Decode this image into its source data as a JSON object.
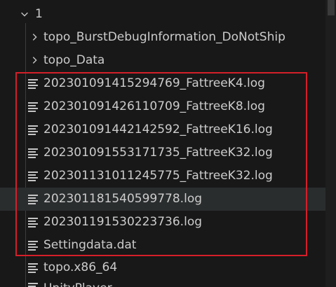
{
  "explorer": {
    "root_folder": {
      "label": "1",
      "expanded": true
    },
    "folders": [
      {
        "label": "topo_BurstDebugInformation_DoNotShip",
        "expanded": false
      },
      {
        "label": "topo_Data",
        "expanded": false
      }
    ],
    "files": [
      {
        "label": "202301091415294769_FattreeK4.log",
        "icon": "file-lines-icon"
      },
      {
        "label": "202301091426110709_FattreeK8.log",
        "icon": "file-lines-icon"
      },
      {
        "label": "202301091442142592_FattreeK16.log",
        "icon": "file-lines-icon"
      },
      {
        "label": "202301091553171735_FattreeK32.log",
        "icon": "file-lines-icon"
      },
      {
        "label": "202301131011245775_FattreeK32.log",
        "icon": "file-lines-icon"
      },
      {
        "label": "202301181540599778.log",
        "icon": "file-lines-icon"
      },
      {
        "label": "202301191530223736.log",
        "icon": "file-lines-icon"
      },
      {
        "label": "Settingdata.dat",
        "icon": "file-lines-icon"
      },
      {
        "label": "topo.x86_64",
        "icon": "file-lines-icon"
      }
    ],
    "cut_off_label": "UnityPlayer",
    "highlight_color": "#d41f2a",
    "hover_color": "#2a2d2e",
    "background_color": "#181818"
  }
}
